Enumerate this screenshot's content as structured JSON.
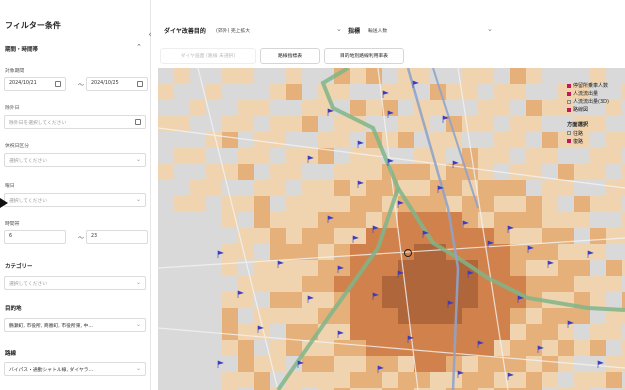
{
  "panel": {
    "title": "フィルター条件",
    "sections": {
      "period": {
        "title": "期間・時間帯"
      },
      "target_period": {
        "label": "対象期間",
        "start": "2024/10/21",
        "end": "2024/10/25"
      },
      "exclude_days": {
        "label": "除外日",
        "placeholder": "除外日を選択してください"
      },
      "holiday": {
        "label": "休祝日区分",
        "placeholder": "選択してください"
      },
      "weekday": {
        "label": "曜日",
        "placeholder": "選択してください"
      },
      "hours": {
        "label": "時間帯",
        "from": "6",
        "to": "23"
      },
      "category": {
        "title": "カテゴリー",
        "placeholder": "選択してください"
      },
      "destination": {
        "title": "目的地",
        "value": "鶴瀬町, 市役所, 商番町, 市役所東, 中..."
      },
      "route": {
        "title": "路線",
        "value": "バイパス・通勤シャトル線, ダイヤラ..."
      }
    },
    "tilde": "〜"
  },
  "topbar": {
    "purpose_label": "ダイヤ改善目的",
    "purpose_value": "(郊外) 売上拡大",
    "index_label": "指標",
    "index_value": "輸送人数"
  },
  "tabs": {
    "diagram": "ダイヤ画面 (路線 未選択)",
    "route_index": "路線指標表",
    "dest_usage": "目的地別路線利用率表"
  },
  "legend": {
    "layers": [
      "停留所乗車人数",
      "人流流出量",
      "人流流出量(3D)",
      "路線図"
    ],
    "layers_checked": [
      true,
      true,
      false,
      true
    ],
    "direction_title": "方面選択",
    "directions": [
      "往路",
      "復路"
    ],
    "direction_selected": "復路"
  },
  "colors": {
    "accent": "#c2185b",
    "heat_low": "#f3d2a8",
    "heat_mid": "#e8a868",
    "heat_high": "#cf7232",
    "heat_peak": "#a8511e",
    "route_green": "#7fb588",
    "route_blue": "#8fa3c9",
    "stop_flag": "#3d3dbf"
  }
}
